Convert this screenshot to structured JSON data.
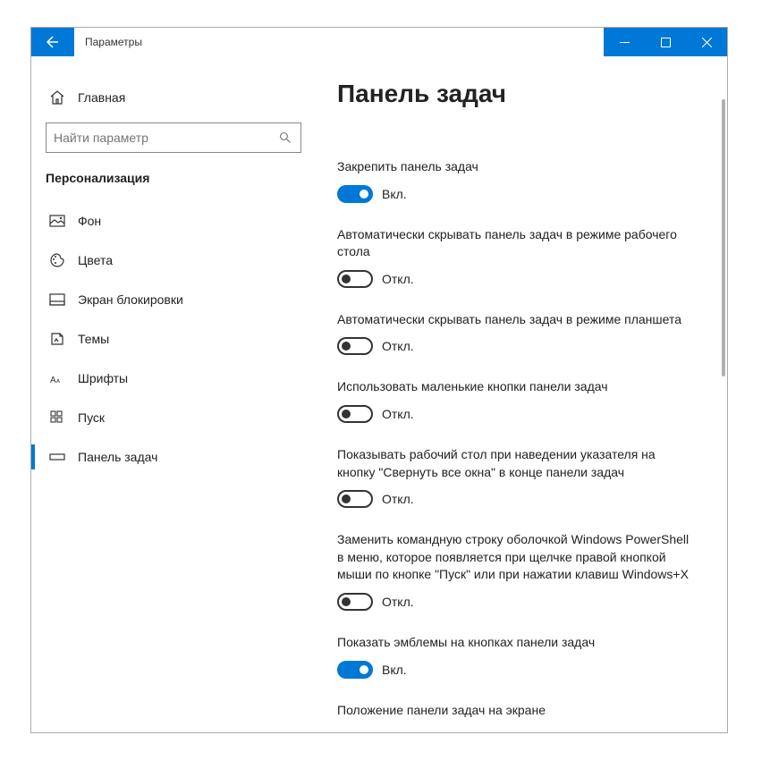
{
  "window": {
    "title": "Параметры"
  },
  "sidebar": {
    "home": "Главная",
    "search_placeholder": "Найти параметр",
    "section": "Персонализация",
    "items": [
      {
        "label": "Фон"
      },
      {
        "label": "Цвета"
      },
      {
        "label": "Экран блокировки"
      },
      {
        "label": "Темы"
      },
      {
        "label": "Шрифты"
      },
      {
        "label": "Пуск"
      },
      {
        "label": "Панель задач"
      }
    ]
  },
  "content": {
    "title": "Панель задач",
    "state_on": "Вкл.",
    "state_off": "Откл.",
    "settings": [
      {
        "label": "Закрепить панель задач",
        "on": true
      },
      {
        "label": "Автоматически скрывать панель задач в режиме рабочего стола",
        "on": false
      },
      {
        "label": "Автоматически скрывать панель задач в режиме планшета",
        "on": false
      },
      {
        "label": "Использовать маленькие кнопки панели задач",
        "on": false
      },
      {
        "label": "Показывать рабочий стол при наведении указателя на кнопку \"Свернуть все окна\" в конце панели задач",
        "on": false
      },
      {
        "label": "Заменить командную строку оболочкой Windows PowerShell в меню, которое появляется при щелчке правой кнопкой мыши по кнопке \"Пуск\" или при нажатии клавиш Windows+X",
        "on": false
      },
      {
        "label": "Показать эмблемы на кнопках панели задач",
        "on": true
      }
    ],
    "next_heading": "Положение панели задач на экране"
  }
}
